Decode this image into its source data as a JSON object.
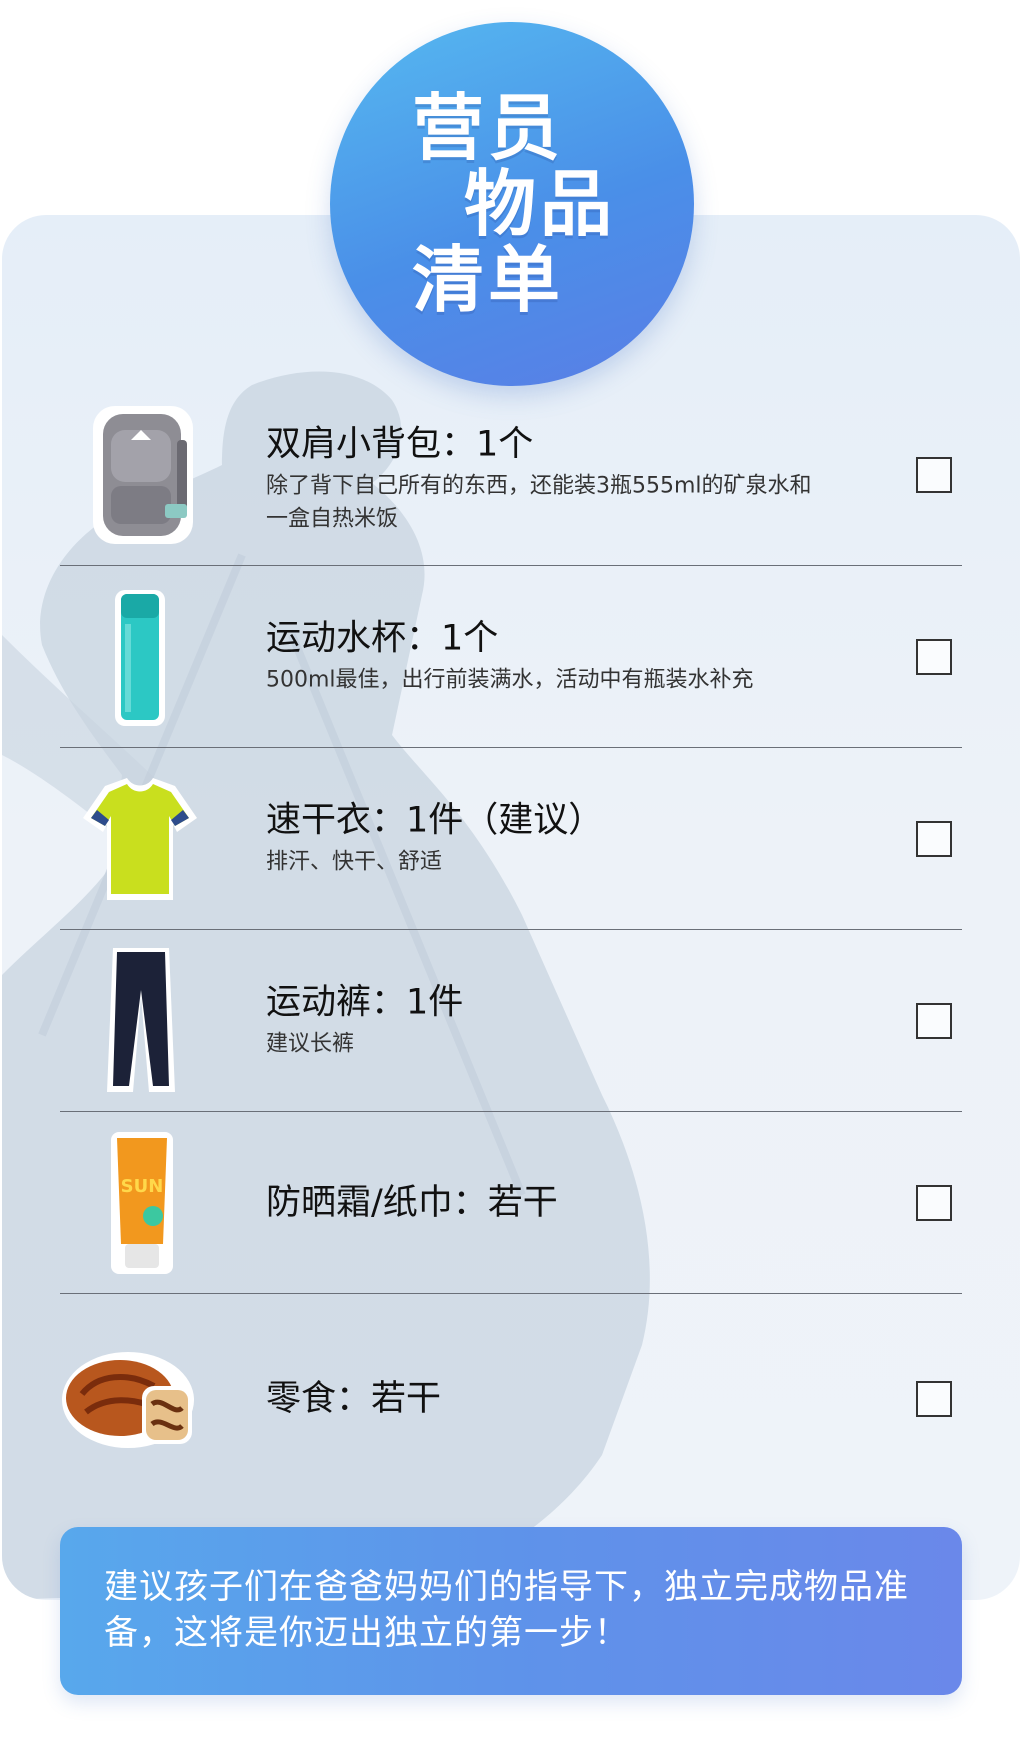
{
  "title": {
    "line1": "营员",
    "line2": "物品",
    "line3": "清单"
  },
  "items": [
    {
      "icon": "backpack",
      "title": "双肩小背包：1个",
      "desc": "除了背下自己所有的东西，还能装3瓶555ml的矿泉水和一盒自热米饭"
    },
    {
      "icon": "water-bottle",
      "title": "运动水杯：1个",
      "desc": "500ml最佳，出行前装满水，活动中有瓶装水补充"
    },
    {
      "icon": "t-shirt",
      "title": "速干衣：1件（建议）",
      "desc": "排汗、快干、舒适"
    },
    {
      "icon": "pants",
      "title": "运动裤：1件",
      "desc": "建议长裤"
    },
    {
      "icon": "sunscreen",
      "title": "防晒霜/纸巾：若干",
      "desc": ""
    },
    {
      "icon": "bread",
      "title": "零食：若干",
      "desc": ""
    }
  ],
  "sunscreen_label": "SUN",
  "banner": {
    "text": "建议孩子们在爸爸妈妈们的指导下，独立完成物品准备，这将是你迈出独立的第一步！"
  },
  "colors": {
    "title_circle": "#4a8fe8",
    "banner": "#5e93ea",
    "card_bg": "#eaf1f8"
  }
}
